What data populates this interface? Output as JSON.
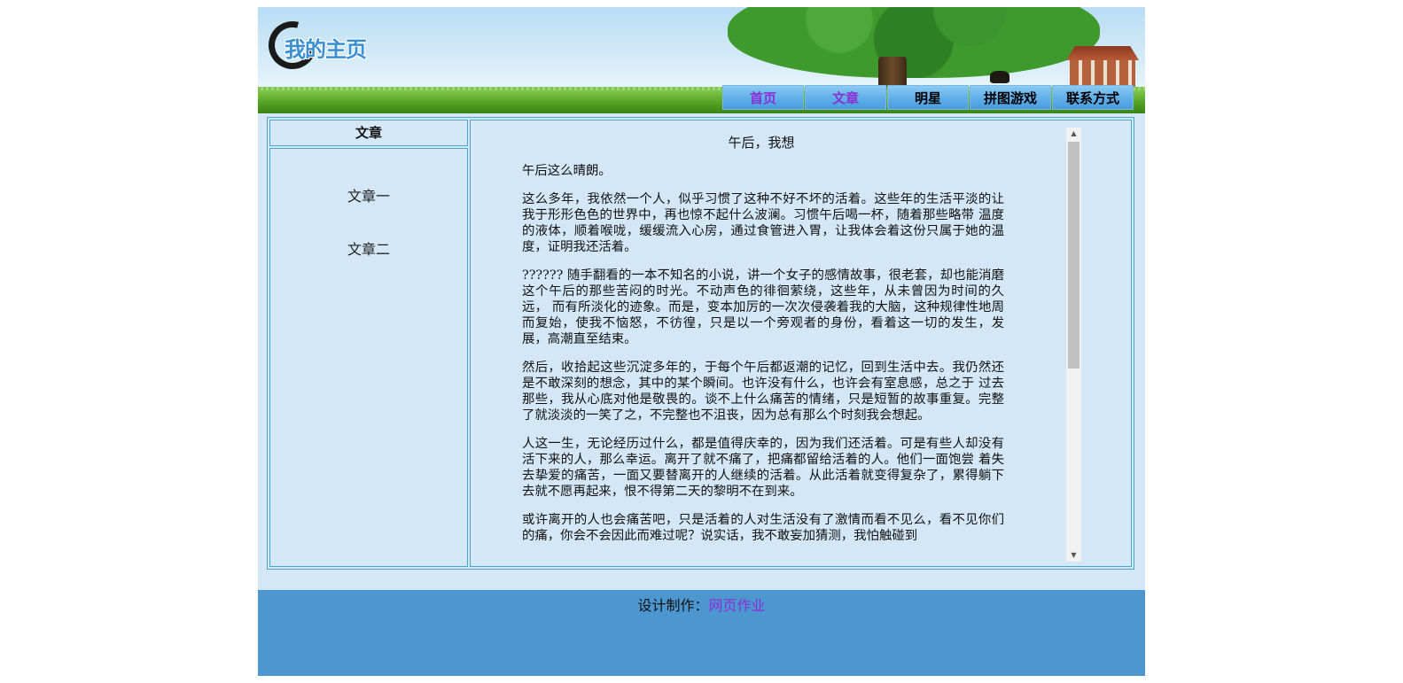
{
  "header": {
    "logo_text": "我的主页",
    "nav": [
      "首页",
      "文章",
      "明星",
      "拼图游戏",
      "联系方式"
    ]
  },
  "sidebar": {
    "heading": "文章",
    "items": [
      "文章一",
      "文章二"
    ]
  },
  "article": {
    "title": "午后，我想",
    "paragraphs": [
      "午后这么晴朗。",
      "这么多年，我依然一个人，似乎习惯了这种不好不坏的活着。这些年的生活平淡的让我于形形色色的世界中，再也惊不起什么波澜。习惯午后喝一杯，随着那些略带 温度的液体，顺着喉咙，缓缓流入心房，通过食管进入胃，让我体会着这份只属于她的温度，证明我还活着。",
      "?????? 随手翻看的一本不知名的小说，讲一个女子的感情故事，很老套，却也能消磨这个午后的那些苦闷的时光。不动声色的徘徊萦绕，这些年，从未曾因为时间的久远， 而有所淡化的迹象。而是，变本加厉的一次次侵袭着我的大脑，这种规律性地周而复始，使我不恼怒，不彷徨，只是以一个旁观者的身份，看着这一切的发生，发 展，高潮直至结束。",
      "然后，收拾起这些沉淀多年的，于每个午后都返潮的记忆，回到生活中去。我仍然还是不敢深刻的想念，其中的某个瞬间。也许没有什么，也许会有室息感，总之于 过去那些，我从心底对他是敬畏的。谈不上什么痛苦的情绪，只是短暂的故事重复。完整了就淡淡的一笑了之，不完整也不沮丧，因为总有那么个时刻我会想起。",
      "人这一生，无论经历过什么，都是值得庆幸的，因为我们还活着。可是有些人却没有活下来的人，那么幸运。离开了就不痛了，把痛都留给活着的人。他们一面饱尝 着失去挚爱的痛苦，一面又要替离开的人继续的活着。从此活着就变得复杂了，累得躺下去就不愿再起来，恨不得第二天的黎明不在到来。",
      "或许离开的人也会痛苦吧，只是活着的人对生活没有了激情而看不见么，看不见你们的痛，你会不会因此而难过呢？说实话，我不敢妄加猜测，我怕触碰到"
    ]
  },
  "footer": {
    "label": "设计制作：",
    "link": "网页作业"
  }
}
